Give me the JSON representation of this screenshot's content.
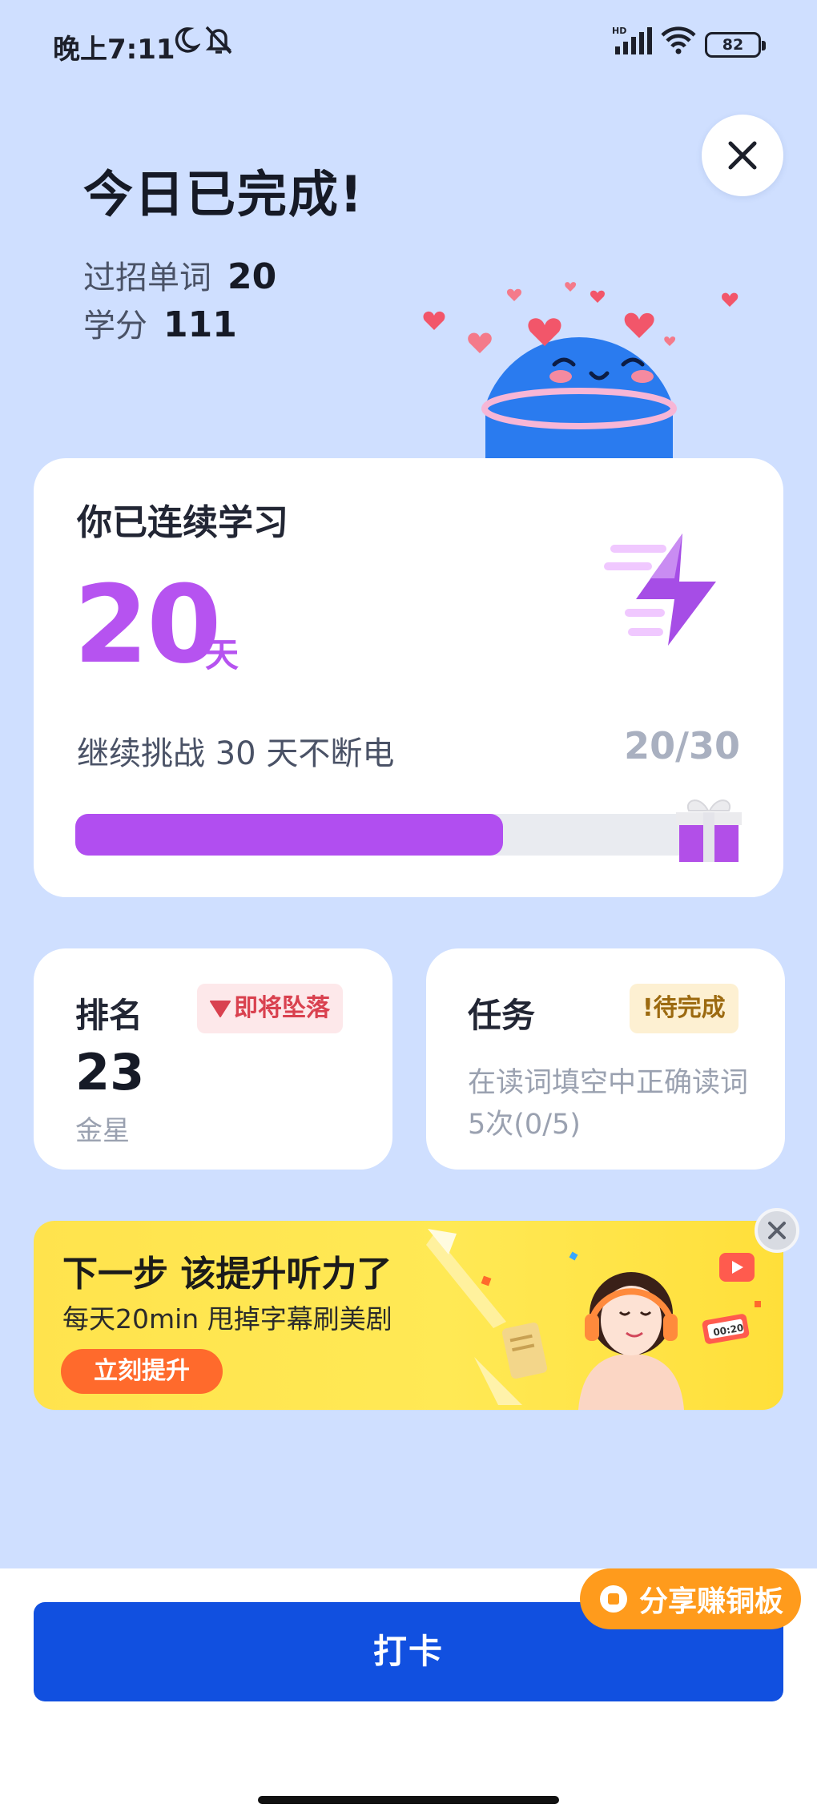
{
  "status_bar": {
    "time": "晚上7:11",
    "battery": "82"
  },
  "header": {
    "title": "今日已完成!",
    "close_icon": "close-icon"
  },
  "stats": [
    {
      "label": "过招单词",
      "value": "20"
    },
    {
      "label": "学分",
      "value": "111"
    }
  ],
  "streak": {
    "label": "你已连续学习",
    "days": "20",
    "unit": "天",
    "challenge": "继续挑战 30 天不断电",
    "progress_text": "20/30",
    "progress_fraction": 0.667,
    "accent": "#b14ef0"
  },
  "rank": {
    "title": "排名",
    "badge": "即将坠落",
    "number": "23",
    "sub": "金星"
  },
  "task": {
    "title": "任务",
    "badge": "!待完成",
    "desc": "在读词填空中正确读词5次(0/5)"
  },
  "banner": {
    "title": "下一步 该提升听力了",
    "subtitle": "每天20min 甩掉字幕刷美剧",
    "button": "立刻提升"
  },
  "share": {
    "label": "分享赚铜板"
  },
  "checkin": {
    "label": "打卡",
    "color": "#1150e0"
  }
}
